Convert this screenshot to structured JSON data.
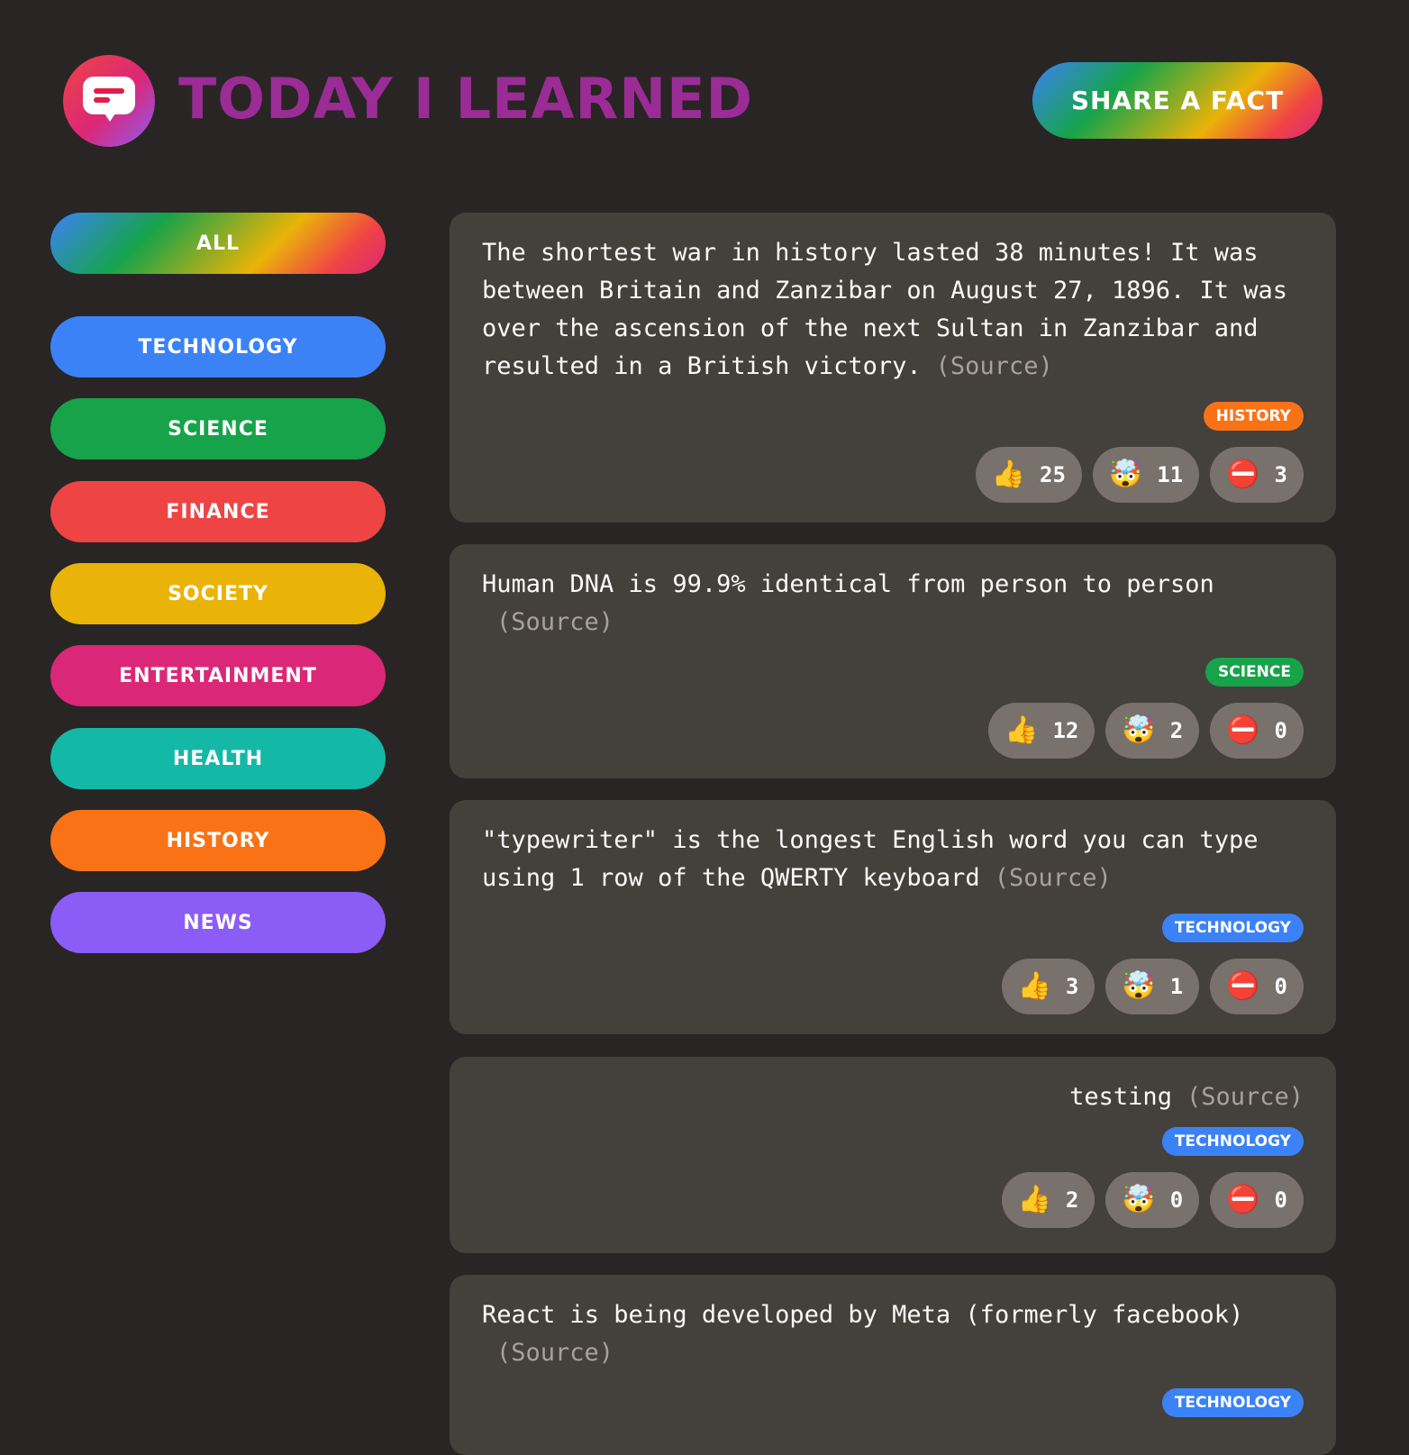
{
  "header": {
    "logo_icon": "chat-bubble-icon",
    "title": "Today I Learned",
    "share_label": "Share a fact"
  },
  "categories": [
    {
      "label": "All",
      "color": "gradient"
    },
    {
      "label": "Technology",
      "color": "#3b82f6"
    },
    {
      "label": "Science",
      "color": "#16a34a"
    },
    {
      "label": "Finance",
      "color": "#ef4444"
    },
    {
      "label": "Society",
      "color": "#eab308"
    },
    {
      "label": "Entertainment",
      "color": "#db2777"
    },
    {
      "label": "Health",
      "color": "#14b8a6"
    },
    {
      "label": "History",
      "color": "#f97316"
    },
    {
      "label": "News",
      "color": "#8b5cf6"
    }
  ],
  "facts": [
    {
      "text": "The shortest war in history lasted 38 minutes! It was between Britain and Zanzibar on August 27, 1896. It was over the ascension of the next Sultan in Zanzibar and resulted in a British victory.",
      "source": "(Source)",
      "category": "History",
      "category_color": "#f97316",
      "votes": {
        "interesting": "25",
        "mindblowing": "11",
        "false": "3"
      }
    },
    {
      "text": "Human DNA is 99.9% identical from person to person",
      "source": "(Source)",
      "category": "Science",
      "category_color": "#16a34a",
      "votes": {
        "interesting": "12",
        "mindblowing": "2",
        "false": "0"
      }
    },
    {
      "text": "\"typewriter\" is the longest English word you can type using 1 row of the QWERTY keyboard",
      "source": "(Source)",
      "category": "Technology",
      "category_color": "#3b82f6",
      "votes": {
        "interesting": "3",
        "mindblowing": "1",
        "false": "0"
      }
    },
    {
      "text": "testing",
      "source": "(Source)",
      "category": "Technology",
      "category_color": "#3b82f6",
      "votes": {
        "interesting": "2",
        "mindblowing": "0",
        "false": "0"
      }
    },
    {
      "text": "React is being developed by Meta (formerly facebook)",
      "source": "(Source)",
      "category": "Technology",
      "category_color": "#3b82f6",
      "votes": {
        "interesting": "",
        "mindblowing": "",
        "false": ""
      }
    }
  ],
  "vote_icons": {
    "interesting": "thumbs-up-icon",
    "mindblowing": "exploding-head-icon",
    "false": "no-entry-icon"
  }
}
